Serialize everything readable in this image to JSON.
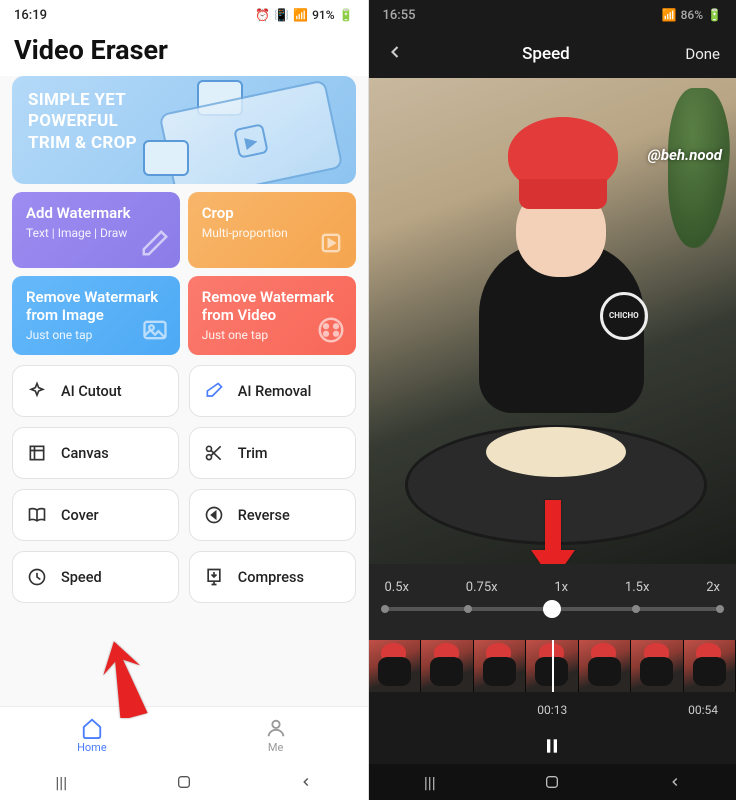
{
  "left": {
    "status": {
      "time": "16:19",
      "battery": "91%"
    },
    "title": "Video Eraser",
    "hero": {
      "line1": "SIMPLE YET",
      "line2": "POWERFUL",
      "line3": "TRIM & CROP"
    },
    "features": [
      {
        "title": "Add Watermark",
        "sub": "Text | Image | Draw",
        "color": "c-purple",
        "icon": "pencil-icon"
      },
      {
        "title": "Crop",
        "sub": "Multi-proportion",
        "color": "c-orange",
        "icon": "crop-icon"
      },
      {
        "title": "Remove Watermark from Image",
        "sub": "Just one tap",
        "color": "c-blue",
        "icon": "image-icon"
      },
      {
        "title": "Remove Watermark from Video",
        "sub": "Just one tap",
        "color": "c-red",
        "icon": "film-icon"
      }
    ],
    "tools": [
      {
        "label": "AI Cutout",
        "icon": "sparkle-icon"
      },
      {
        "label": "AI Removal",
        "icon": "eraser-icon"
      },
      {
        "label": "Canvas",
        "icon": "canvas-icon"
      },
      {
        "label": "Trim",
        "icon": "scissors-icon"
      },
      {
        "label": "Cover",
        "icon": "book-icon"
      },
      {
        "label": "Reverse",
        "icon": "reverse-icon"
      },
      {
        "label": "Speed",
        "icon": "speed-icon"
      },
      {
        "label": "Compress",
        "icon": "compress-icon"
      }
    ],
    "nav": {
      "home": "Home",
      "me": "Me"
    }
  },
  "right": {
    "status": {
      "time": "16:55",
      "battery": "86%"
    },
    "header": {
      "title": "Speed",
      "done": "Done"
    },
    "video": {
      "watermark": "@beh.nood",
      "logo": "CHICHO"
    },
    "speeds": [
      "0.5x",
      "0.75x",
      "1x",
      "1.5x",
      "2x"
    ],
    "timecodes": {
      "current": "00:13",
      "total": "00:54"
    }
  }
}
